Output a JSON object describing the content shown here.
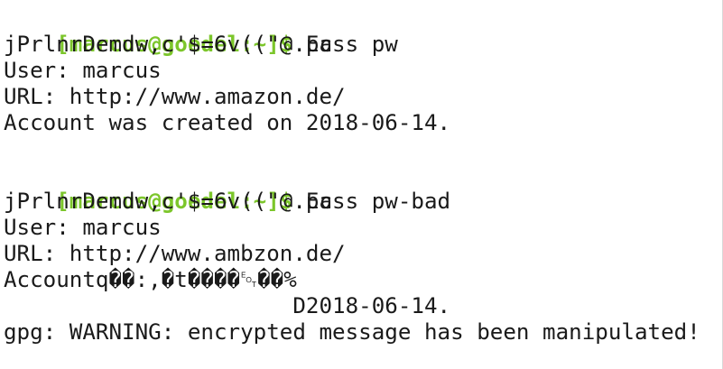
{
  "terminal": {
    "lines": [
      {
        "prompt": "[marcus@goedel:~]$",
        "command": " pass pw"
      },
      {
        "text": "jPrlnrDemdw,c'$=6v((\"@.Ec"
      },
      {
        "text": "User: marcus"
      },
      {
        "text": "URL: http://www.amazon.de/"
      },
      {
        "text": "Account was created on 2018-06-14."
      },
      {
        "text": ""
      },
      {
        "prompt": "[marcus@goedel:~]$",
        "command": " pass pw-bad"
      },
      {
        "text": "jPrlnrDemdw,c'$=6v((\"@.Ec"
      },
      {
        "text": "User: marcus"
      },
      {
        "text": "URL: http://www.ambzon.de/"
      },
      {
        "text": "Accountq��:,�t����␄��%"
      },
      {
        "text": "                      D2018-06-14."
      },
      {
        "text": "gpg: WARNING: encrypted message has been manipulated!"
      }
    ]
  },
  "colors": {
    "background": "#ffffff",
    "prompt": "#7cc62b",
    "text": "#1a1a1a"
  }
}
